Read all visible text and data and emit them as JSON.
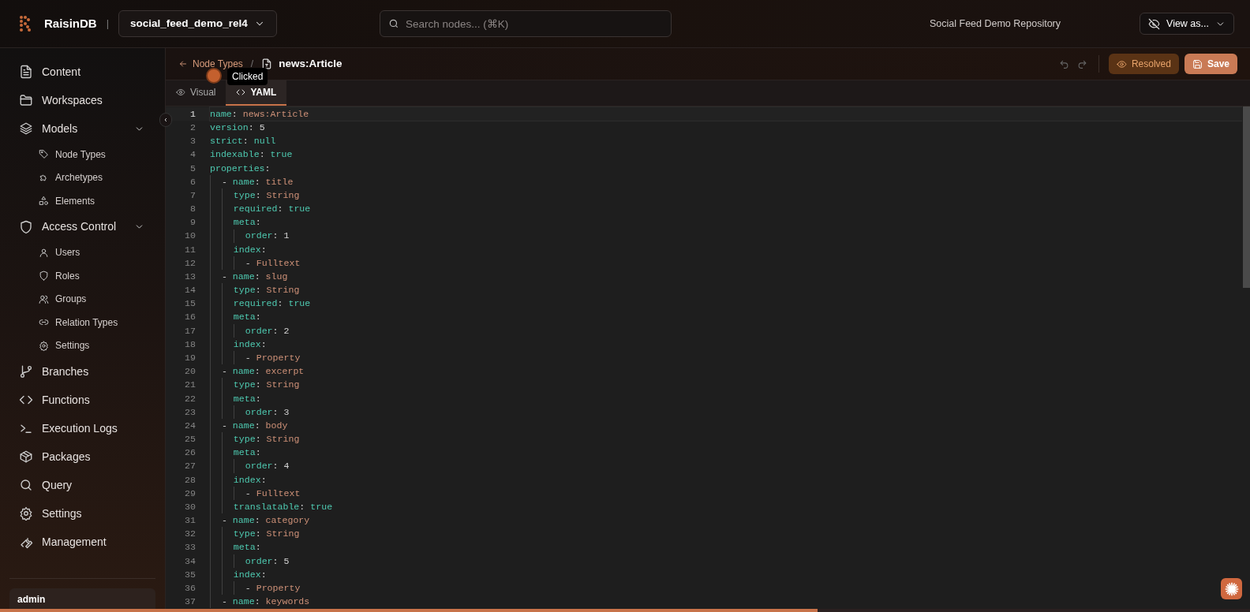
{
  "app": {
    "name": "RaisinDB",
    "separator": "|",
    "repository_selector": "social_feed_demo_rel4",
    "search": {
      "placeholder": "Search nodes... (⌘K)"
    },
    "repository_title": "Social Feed Demo Repository",
    "view_as": "View as..."
  },
  "sidebar": {
    "items": [
      {
        "label": "Content"
      },
      {
        "label": "Workspaces"
      },
      {
        "label": "Models",
        "expanded": true,
        "children": [
          {
            "label": "Node Types"
          },
          {
            "label": "Archetypes"
          },
          {
            "label": "Elements"
          }
        ]
      },
      {
        "label": "Access Control",
        "expanded": true,
        "children": [
          {
            "label": "Users"
          },
          {
            "label": "Roles"
          },
          {
            "label": "Groups"
          },
          {
            "label": "Relation Types"
          },
          {
            "label": "Settings"
          }
        ]
      },
      {
        "label": "Branches"
      },
      {
        "label": "Functions"
      },
      {
        "label": "Execution Logs"
      },
      {
        "label": "Packages"
      },
      {
        "label": "Query"
      },
      {
        "label": "Settings"
      },
      {
        "label": "Management"
      }
    ],
    "user": {
      "name": "admin"
    }
  },
  "editor": {
    "breadcrumb": {
      "back": "Node Types",
      "separator": "/",
      "current": "news:Article"
    },
    "tooltip": "Clicked",
    "actions": {
      "resolved": "Resolved",
      "save": "Save"
    },
    "tabs": [
      {
        "label": "Visual",
        "selected": false
      },
      {
        "label": "YAML",
        "selected": true
      }
    ],
    "lines": [
      {
        "number": "1",
        "current": true,
        "tokens": [
          {
            "kind": "key",
            "text": "name"
          },
          {
            "kind": "punct",
            "text": ": "
          },
          {
            "kind": "string",
            "text": "news:Article"
          }
        ]
      },
      {
        "number": "2",
        "current": false,
        "tokens": [
          {
            "kind": "key",
            "text": "version"
          },
          {
            "kind": "punct",
            "text": ": "
          },
          {
            "kind": "number",
            "text": "5"
          }
        ]
      },
      {
        "number": "3",
        "current": false,
        "tokens": [
          {
            "kind": "key",
            "text": "strict"
          },
          {
            "kind": "punct",
            "text": ": "
          },
          {
            "kind": "keyword",
            "text": "null"
          }
        ]
      },
      {
        "number": "4",
        "current": false,
        "tokens": [
          {
            "kind": "key",
            "text": "indexable"
          },
          {
            "kind": "punct",
            "text": ": "
          },
          {
            "kind": "keyword",
            "text": "true"
          }
        ]
      },
      {
        "number": "5",
        "current": false,
        "tokens": [
          {
            "kind": "key",
            "text": "properties"
          },
          {
            "kind": "punct",
            "text": ":"
          }
        ]
      },
      {
        "number": "6",
        "current": false,
        "tokens": [
          {
            "kind": "punct",
            "text": "  - "
          },
          {
            "kind": "key",
            "text": "name"
          },
          {
            "kind": "punct",
            "text": ": "
          },
          {
            "kind": "string",
            "text": "title"
          }
        ]
      },
      {
        "number": "7",
        "current": false,
        "tokens": [
          {
            "kind": "key",
            "text": "    type"
          },
          {
            "kind": "punct",
            "text": ": "
          },
          {
            "kind": "string",
            "text": "String"
          }
        ]
      },
      {
        "number": "8",
        "current": false,
        "tokens": [
          {
            "kind": "key",
            "text": "    required"
          },
          {
            "kind": "punct",
            "text": ": "
          },
          {
            "kind": "keyword",
            "text": "true"
          }
        ]
      },
      {
        "number": "9",
        "current": false,
        "tokens": [
          {
            "kind": "key",
            "text": "    meta"
          },
          {
            "kind": "punct",
            "text": ":"
          }
        ]
      },
      {
        "number": "10",
        "current": false,
        "tokens": [
          {
            "kind": "key",
            "text": "      order"
          },
          {
            "kind": "punct",
            "text": ": "
          },
          {
            "kind": "number",
            "text": "1"
          }
        ]
      },
      {
        "number": "11",
        "current": false,
        "tokens": [
          {
            "kind": "key",
            "text": "    index"
          },
          {
            "kind": "punct",
            "text": ":"
          }
        ]
      },
      {
        "number": "12",
        "current": false,
        "tokens": [
          {
            "kind": "punct",
            "text": "      - "
          },
          {
            "kind": "string",
            "text": "Fulltext"
          }
        ]
      },
      {
        "number": "13",
        "current": false,
        "tokens": [
          {
            "kind": "punct",
            "text": "  - "
          },
          {
            "kind": "key",
            "text": "name"
          },
          {
            "kind": "punct",
            "text": ": "
          },
          {
            "kind": "string",
            "text": "slug"
          }
        ]
      },
      {
        "number": "14",
        "current": false,
        "tokens": [
          {
            "kind": "key",
            "text": "    type"
          },
          {
            "kind": "punct",
            "text": ": "
          },
          {
            "kind": "string",
            "text": "String"
          }
        ]
      },
      {
        "number": "15",
        "current": false,
        "tokens": [
          {
            "kind": "key",
            "text": "    required"
          },
          {
            "kind": "punct",
            "text": ": "
          },
          {
            "kind": "keyword",
            "text": "true"
          }
        ]
      },
      {
        "number": "16",
        "current": false,
        "tokens": [
          {
            "kind": "key",
            "text": "    meta"
          },
          {
            "kind": "punct",
            "text": ":"
          }
        ]
      },
      {
        "number": "17",
        "current": false,
        "tokens": [
          {
            "kind": "key",
            "text": "      order"
          },
          {
            "kind": "punct",
            "text": ": "
          },
          {
            "kind": "number",
            "text": "2"
          }
        ]
      },
      {
        "number": "18",
        "current": false,
        "tokens": [
          {
            "kind": "key",
            "text": "    index"
          },
          {
            "kind": "punct",
            "text": ":"
          }
        ]
      },
      {
        "number": "19",
        "current": false,
        "tokens": [
          {
            "kind": "punct",
            "text": "      - "
          },
          {
            "kind": "string",
            "text": "Property"
          }
        ]
      },
      {
        "number": "20",
        "current": false,
        "tokens": [
          {
            "kind": "punct",
            "text": "  - "
          },
          {
            "kind": "key",
            "text": "name"
          },
          {
            "kind": "punct",
            "text": ": "
          },
          {
            "kind": "string",
            "text": "excerpt"
          }
        ]
      },
      {
        "number": "21",
        "current": false,
        "tokens": [
          {
            "kind": "key",
            "text": "    type"
          },
          {
            "kind": "punct",
            "text": ": "
          },
          {
            "kind": "string",
            "text": "String"
          }
        ]
      },
      {
        "number": "22",
        "current": false,
        "tokens": [
          {
            "kind": "key",
            "text": "    meta"
          },
          {
            "kind": "punct",
            "text": ":"
          }
        ]
      },
      {
        "number": "23",
        "current": false,
        "tokens": [
          {
            "kind": "key",
            "text": "      order"
          },
          {
            "kind": "punct",
            "text": ": "
          },
          {
            "kind": "number",
            "text": "3"
          }
        ]
      },
      {
        "number": "24",
        "current": false,
        "tokens": [
          {
            "kind": "punct",
            "text": "  - "
          },
          {
            "kind": "key",
            "text": "name"
          },
          {
            "kind": "punct",
            "text": ": "
          },
          {
            "kind": "string",
            "text": "body"
          }
        ]
      },
      {
        "number": "25",
        "current": false,
        "tokens": [
          {
            "kind": "key",
            "text": "    type"
          },
          {
            "kind": "punct",
            "text": ": "
          },
          {
            "kind": "string",
            "text": "String"
          }
        ]
      },
      {
        "number": "26",
        "current": false,
        "tokens": [
          {
            "kind": "key",
            "text": "    meta"
          },
          {
            "kind": "punct",
            "text": ":"
          }
        ]
      },
      {
        "number": "27",
        "current": false,
        "tokens": [
          {
            "kind": "key",
            "text": "      order"
          },
          {
            "kind": "punct",
            "text": ": "
          },
          {
            "kind": "number",
            "text": "4"
          }
        ]
      },
      {
        "number": "28",
        "current": false,
        "tokens": [
          {
            "kind": "key",
            "text": "    index"
          },
          {
            "kind": "punct",
            "text": ":"
          }
        ]
      },
      {
        "number": "29",
        "current": false,
        "tokens": [
          {
            "kind": "punct",
            "text": "      - "
          },
          {
            "kind": "string",
            "text": "Fulltext"
          }
        ]
      },
      {
        "number": "30",
        "current": false,
        "tokens": [
          {
            "kind": "key",
            "text": "    translatable"
          },
          {
            "kind": "punct",
            "text": ": "
          },
          {
            "kind": "keyword",
            "text": "true"
          }
        ]
      },
      {
        "number": "31",
        "current": false,
        "tokens": [
          {
            "kind": "punct",
            "text": "  - "
          },
          {
            "kind": "key",
            "text": "name"
          },
          {
            "kind": "punct",
            "text": ": "
          },
          {
            "kind": "string",
            "text": "category"
          }
        ]
      },
      {
        "number": "32",
        "current": false,
        "tokens": [
          {
            "kind": "key",
            "text": "    type"
          },
          {
            "kind": "punct",
            "text": ": "
          },
          {
            "kind": "string",
            "text": "String"
          }
        ]
      },
      {
        "number": "33",
        "current": false,
        "tokens": [
          {
            "kind": "key",
            "text": "    meta"
          },
          {
            "kind": "punct",
            "text": ":"
          }
        ]
      },
      {
        "number": "34",
        "current": false,
        "tokens": [
          {
            "kind": "key",
            "text": "      order"
          },
          {
            "kind": "punct",
            "text": ": "
          },
          {
            "kind": "number",
            "text": "5"
          }
        ]
      },
      {
        "number": "35",
        "current": false,
        "tokens": [
          {
            "kind": "key",
            "text": "    index"
          },
          {
            "kind": "punct",
            "text": ":"
          }
        ]
      },
      {
        "number": "36",
        "current": false,
        "tokens": [
          {
            "kind": "punct",
            "text": "      - "
          },
          {
            "kind": "string",
            "text": "Property"
          }
        ]
      },
      {
        "number": "37",
        "current": false,
        "tokens": [
          {
            "kind": "punct",
            "text": "  - "
          },
          {
            "kind": "key",
            "text": "name"
          },
          {
            "kind": "punct",
            "text": ": "
          },
          {
            "kind": "string",
            "text": "keywords"
          }
        ]
      }
    ]
  },
  "loading_bar": {
    "level": 0.654
  }
}
